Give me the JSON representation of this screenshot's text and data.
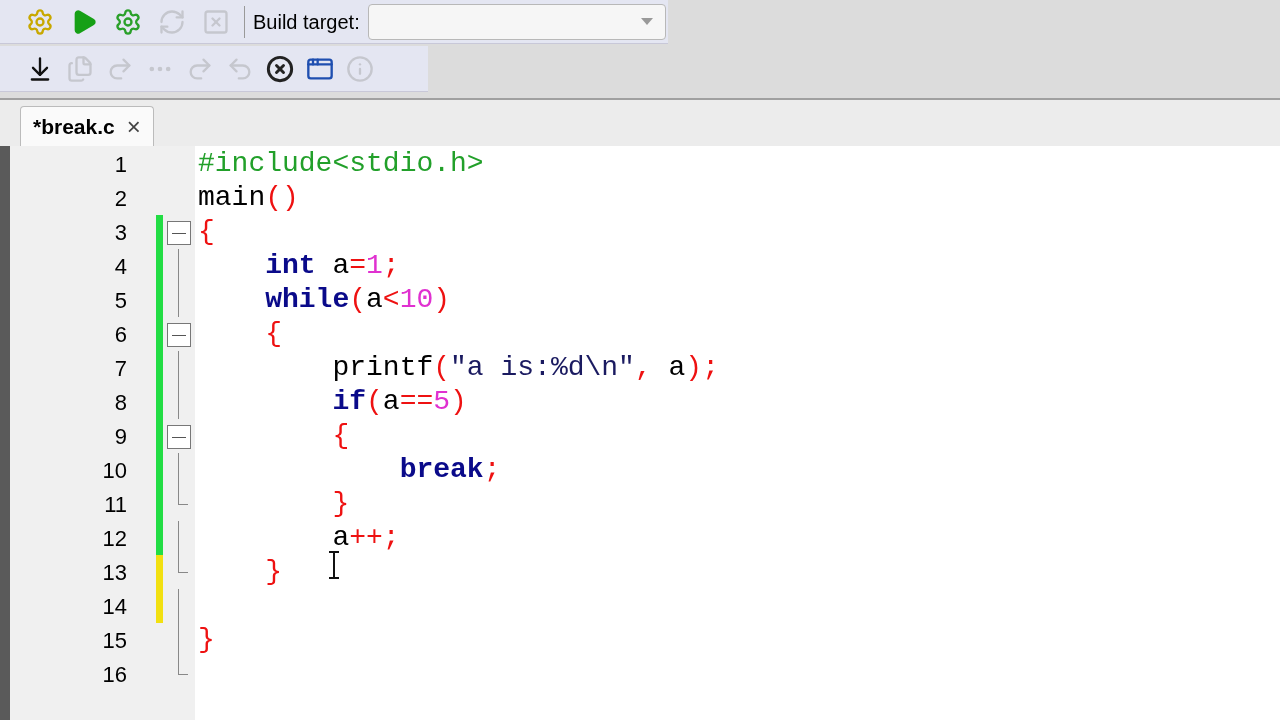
{
  "build_toolbar": {
    "buttons": [
      {
        "kind": "build",
        "disabled": false
      },
      {
        "kind": "run",
        "disabled": false
      },
      {
        "kind": "build-run",
        "disabled": false
      },
      {
        "kind": "rebuild",
        "disabled": true
      },
      {
        "kind": "abort",
        "disabled": true
      }
    ],
    "target_label": "Build target:"
  },
  "debug_toolbar": {
    "buttons": [
      {
        "kind": "run-to-cursor",
        "disabled": false
      },
      {
        "kind": "next-line",
        "disabled": true
      },
      {
        "kind": "step-into",
        "disabled": true
      },
      {
        "kind": "next-instruction",
        "disabled": true
      },
      {
        "kind": "step-out",
        "disabled": true
      },
      {
        "kind": "step-back",
        "disabled": true
      },
      {
        "kind": "stop",
        "disabled": false
      },
      {
        "kind": "debug-window",
        "disabled": false
      },
      {
        "kind": "info",
        "disabled": true
      }
    ]
  },
  "tabs": [
    {
      "label": "*break.c",
      "selected": true,
      "close": "×"
    }
  ],
  "editor": {
    "lines": [
      {
        "number": "1",
        "tokens": [
          {
            "kind": "preproc",
            "text": "#include<stdio.h>"
          }
        ]
      },
      {
        "number": "2",
        "tokens": [
          {
            "kind": "plain",
            "text": "main"
          },
          {
            "kind": "op",
            "text": "()"
          }
        ]
      },
      {
        "number": "3",
        "modified": true,
        "saved": true,
        "fold": {
          "kind": "open"
        },
        "tokens": [
          {
            "kind": "op",
            "text": "{"
          }
        ]
      },
      {
        "number": "4",
        "modified": true,
        "saved": true,
        "fold": {
          "kind": "line"
        },
        "tokens": [
          {
            "kind": "keyword",
            "text": "    int"
          },
          {
            "kind": "plain",
            "text": " a"
          },
          {
            "kind": "op",
            "text": "="
          },
          {
            "kind": "number",
            "text": "1"
          },
          {
            "kind": "op",
            "text": ";"
          }
        ]
      },
      {
        "number": "5",
        "modified": true,
        "saved": true,
        "fold": {
          "kind": "line"
        },
        "tokens": [
          {
            "kind": "keyword",
            "text": "    while"
          },
          {
            "kind": "op",
            "text": "("
          },
          {
            "kind": "plain",
            "text": "a"
          },
          {
            "kind": "op",
            "text": "<"
          },
          {
            "kind": "number",
            "text": "10"
          },
          {
            "kind": "op",
            "text": ")"
          }
        ]
      },
      {
        "number": "6",
        "modified": true,
        "saved": true,
        "fold": {
          "kind": "open"
        },
        "tokens": [
          {
            "kind": "op",
            "text": "    {"
          }
        ]
      },
      {
        "number": "7",
        "modified": true,
        "saved": true,
        "fold": {
          "kind": "line"
        },
        "tokens": [
          {
            "kind": "plain",
            "text": "        printf"
          },
          {
            "kind": "op",
            "text": "("
          },
          {
            "kind": "string",
            "text": "\"a is:%d\\n\""
          },
          {
            "kind": "op",
            "text": ","
          },
          {
            "kind": "plain",
            "text": " a"
          },
          {
            "kind": "op",
            "text": ");"
          }
        ]
      },
      {
        "number": "8",
        "modified": true,
        "saved": true,
        "fold": {
          "kind": "line"
        },
        "tokens": [
          {
            "kind": "keyword",
            "text": "        if"
          },
          {
            "kind": "op",
            "text": "("
          },
          {
            "kind": "plain",
            "text": "a"
          },
          {
            "kind": "op",
            "text": "=="
          },
          {
            "kind": "number",
            "text": "5"
          },
          {
            "kind": "op",
            "text": ")"
          }
        ]
      },
      {
        "number": "9",
        "modified": true,
        "saved": true,
        "fold": {
          "kind": "open"
        },
        "tokens": [
          {
            "kind": "op",
            "text": "        {"
          }
        ]
      },
      {
        "number": "10",
        "modified": true,
        "saved": true,
        "fold": {
          "kind": "line"
        },
        "tokens": [
          {
            "kind": "keyword",
            "text": "            break"
          },
          {
            "kind": "op",
            "text": ";"
          }
        ]
      },
      {
        "number": "11",
        "modified": true,
        "saved": true,
        "fold": {
          "kind": "end"
        },
        "tokens": [
          {
            "kind": "op",
            "text": "        }"
          }
        ]
      },
      {
        "number": "12",
        "modified": true,
        "saved": true,
        "fold": {
          "kind": "line"
        },
        "tokens": [
          {
            "kind": "plain",
            "text": "        a"
          },
          {
            "kind": "op",
            "text": "++;"
          }
        ]
      },
      {
        "number": "13",
        "modified": true,
        "saved": false,
        "fold": {
          "kind": "end"
        },
        "tokens": [
          {
            "kind": "op",
            "text": "    }"
          }
        ]
      },
      {
        "number": "14",
        "modified": true,
        "saved": false,
        "fold": {
          "kind": "line"
        }
      },
      {
        "number": "15",
        "fold": {
          "kind": "line"
        },
        "tokens": [
          {
            "kind": "op",
            "text": "}"
          }
        ]
      },
      {
        "number": "16",
        "fold": {
          "kind": "end"
        }
      }
    ]
  }
}
